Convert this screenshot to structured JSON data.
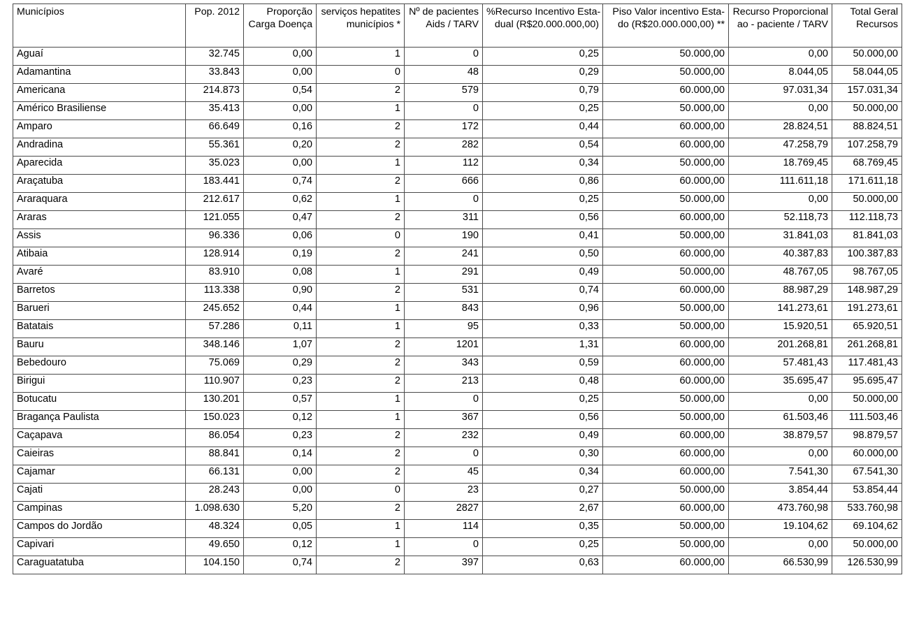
{
  "table": {
    "columns": [
      {
        "key": "municipio",
        "header": "Municípios",
        "align": "left"
      },
      {
        "key": "pop2012",
        "header": "Pop. 2012",
        "align": "right"
      },
      {
        "key": "proporcao",
        "header": "Proporção Carga Doença",
        "header_line1": "Proporção",
        "header_line2": "Carga Doença",
        "align": "right"
      },
      {
        "key": "servicos",
        "header": "serviços hepatites municípios *",
        "header_line1": "serviços hepatites",
        "header_line2": "municípios *",
        "align": "right"
      },
      {
        "key": "pacientes",
        "header": "Nº de pacientes Aids / TARV",
        "header_line1": "Nº de pacientes",
        "header_line2": "Aids / TARV",
        "align": "right"
      },
      {
        "key": "pct_recurso",
        "header": "%Recurso Incentivo Estadual (R$20.000.000,00)",
        "header_line1": "%Recurso Incentivo Esta-",
        "header_line2": "dual (R$20.000.000,00)",
        "align": "right"
      },
      {
        "key": "piso_valor",
        "header": "Piso Valor incentivo Estado (R$20.000.000,00) **",
        "header_line1": "Piso Valor incentivo Esta-",
        "header_line2": "do (R$20.000.000,00) **",
        "align": "right"
      },
      {
        "key": "recurso_prop",
        "header": "Recurso Proporcional ao - paciente / TARV",
        "header_line1": "Recurso Proporcional",
        "header_line2": "ao - paciente / TARV",
        "align": "right"
      },
      {
        "key": "total_geral",
        "header": "Total Geral Recursos",
        "header_line1": "Total Geral",
        "header_line2": "Recursos",
        "align": "right"
      }
    ],
    "rows": [
      [
        "Aguaí",
        "32.745",
        "0,00",
        "1",
        "0",
        "0,25",
        "50.000,00",
        "0,00",
        "50.000,00"
      ],
      [
        "Adamantina",
        "33.843",
        "0,00",
        "0",
        "48",
        "0,29",
        "50.000,00",
        "8.044,05",
        "58.044,05"
      ],
      [
        "Americana",
        "214.873",
        "0,54",
        "2",
        "579",
        "0,79",
        "60.000,00",
        "97.031,34",
        "157.031,34"
      ],
      [
        "Américo Brasiliense",
        "35.413",
        "0,00",
        "1",
        "0",
        "0,25",
        "50.000,00",
        "0,00",
        "50.000,00"
      ],
      [
        "Amparo",
        "66.649",
        "0,16",
        "2",
        "172",
        "0,44",
        "60.000,00",
        "28.824,51",
        "88.824,51"
      ],
      [
        "Andradina",
        "55.361",
        "0,20",
        "2",
        "282",
        "0,54",
        "60.000,00",
        "47.258,79",
        "107.258,79"
      ],
      [
        "Aparecida",
        "35.023",
        "0,00",
        "1",
        "112",
        "0,34",
        "50.000,00",
        "18.769,45",
        "68.769,45"
      ],
      [
        "Araçatuba",
        "183.441",
        "0,74",
        "2",
        "666",
        "0,86",
        "60.000,00",
        "111.611,18",
        "171.611,18"
      ],
      [
        "Araraquara",
        "212.617",
        "0,62",
        "1",
        "0",
        "0,25",
        "50.000,00",
        "0,00",
        "50.000,00"
      ],
      [
        "Araras",
        "121.055",
        "0,47",
        "2",
        "311",
        "0,56",
        "60.000,00",
        "52.118,73",
        "112.118,73"
      ],
      [
        "Assis",
        "96.336",
        "0,06",
        "0",
        "190",
        "0,41",
        "50.000,00",
        "31.841,03",
        "81.841,03"
      ],
      [
        "Atibaia",
        "128.914",
        "0,19",
        "2",
        "241",
        "0,50",
        "60.000,00",
        "40.387,83",
        "100.387,83"
      ],
      [
        "Avaré",
        "83.910",
        "0,08",
        "1",
        "291",
        "0,49",
        "50.000,00",
        "48.767,05",
        "98.767,05"
      ],
      [
        "Barretos",
        "113.338",
        "0,90",
        "2",
        "531",
        "0,74",
        "60.000,00",
        "88.987,29",
        "148.987,29"
      ],
      [
        "Barueri",
        "245.652",
        "0,44",
        "1",
        "843",
        "0,96",
        "50.000,00",
        "141.273,61",
        "191.273,61"
      ],
      [
        "Batatais",
        "57.286",
        "0,11",
        "1",
        "95",
        "0,33",
        "50.000,00",
        "15.920,51",
        "65.920,51"
      ],
      [
        "Bauru",
        "348.146",
        "1,07",
        "2",
        "1201",
        "1,31",
        "60.000,00",
        "201.268,81",
        "261.268,81"
      ],
      [
        "Bebedouro",
        "75.069",
        "0,29",
        "2",
        "343",
        "0,59",
        "60.000,00",
        "57.481,43",
        "117.481,43"
      ],
      [
        "Birigui",
        "110.907",
        "0,23",
        "2",
        "213",
        "0,48",
        "60.000,00",
        "35.695,47",
        "95.695,47"
      ],
      [
        "Botucatu",
        "130.201",
        "0,57",
        "1",
        "0",
        "0,25",
        "50.000,00",
        "0,00",
        "50.000,00"
      ],
      [
        "Bragança Paulista",
        "150.023",
        "0,12",
        "1",
        "367",
        "0,56",
        "50.000,00",
        "61.503,46",
        "111.503,46"
      ],
      [
        "Caçapava",
        "86.054",
        "0,23",
        "2",
        "232",
        "0,49",
        "60.000,00",
        "38.879,57",
        "98.879,57"
      ],
      [
        "Caieiras",
        "88.841",
        "0,14",
        "2",
        "0",
        "0,30",
        "60.000,00",
        "0,00",
        "60.000,00"
      ],
      [
        "Cajamar",
        "66.131",
        "0,00",
        "2",
        "45",
        "0,34",
        "60.000,00",
        "7.541,30",
        "67.541,30"
      ],
      [
        "Cajati",
        "28.243",
        "0,00",
        "0",
        "23",
        "0,27",
        "50.000,00",
        "3.854,44",
        "53.854,44"
      ],
      [
        "Campinas",
        "1.098.630",
        "5,20",
        "2",
        "2827",
        "2,67",
        "60.000,00",
        "473.760,98",
        "533.760,98"
      ],
      [
        "Campos do Jordão",
        "48.324",
        "0,05",
        "1",
        "114",
        "0,35",
        "50.000,00",
        "19.104,62",
        "69.104,62"
      ],
      [
        "Capivari",
        "49.650",
        "0,12",
        "1",
        "0",
        "0,25",
        "50.000,00",
        "0,00",
        "50.000,00"
      ],
      [
        "Caraguatatuba",
        "104.150",
        "0,74",
        "2",
        "397",
        "0,63",
        "60.000,00",
        "66.530,99",
        "126.530,99"
      ]
    ]
  }
}
